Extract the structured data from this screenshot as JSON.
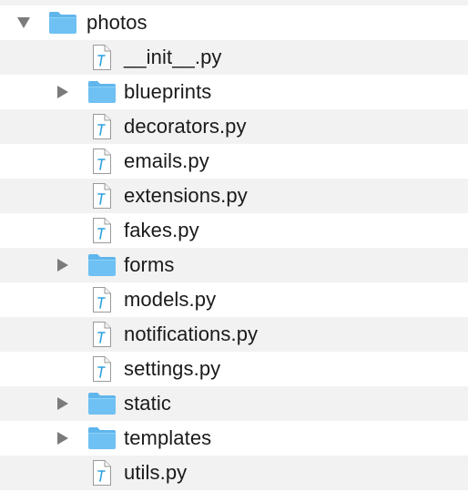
{
  "root": {
    "name": "photos",
    "expanded": true,
    "icon": "folder-icon"
  },
  "items": [
    {
      "name": "__init__.py",
      "type": "file",
      "icon": "python-file-icon"
    },
    {
      "name": "blueprints",
      "type": "folder",
      "icon": "folder-icon",
      "expanded": false
    },
    {
      "name": "decorators.py",
      "type": "file",
      "icon": "python-file-icon"
    },
    {
      "name": "emails.py",
      "type": "file",
      "icon": "python-file-icon"
    },
    {
      "name": "extensions.py",
      "type": "file",
      "icon": "python-file-icon"
    },
    {
      "name": "fakes.py",
      "type": "file",
      "icon": "python-file-icon"
    },
    {
      "name": "forms",
      "type": "folder",
      "icon": "folder-icon",
      "expanded": false
    },
    {
      "name": "models.py",
      "type": "file",
      "icon": "python-file-icon"
    },
    {
      "name": "notifications.py",
      "type": "file",
      "icon": "python-file-icon"
    },
    {
      "name": "settings.py",
      "type": "file",
      "icon": "python-file-icon"
    },
    {
      "name": "static",
      "type": "folder",
      "icon": "folder-icon",
      "expanded": false
    },
    {
      "name": "templates",
      "type": "folder",
      "icon": "folder-icon",
      "expanded": false
    },
    {
      "name": "utils.py",
      "type": "file",
      "icon": "python-file-icon"
    }
  ],
  "colors": {
    "stripe": "#f2f2f2",
    "folder_body": "#6fc1f3",
    "folder_tab": "#5fb6ec",
    "triangle": "#7b7b7b",
    "file_accent": "#2b9fe0"
  }
}
